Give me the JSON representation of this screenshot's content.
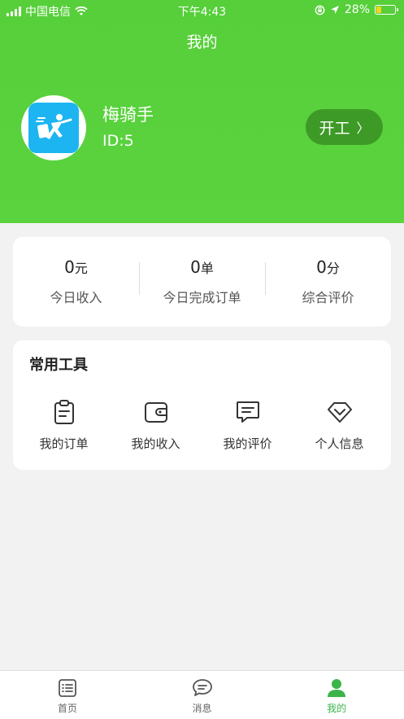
{
  "status_bar": {
    "carrier": "中国电信",
    "time": "下午4:43",
    "battery": "28%"
  },
  "header": {
    "title": "我的"
  },
  "profile": {
    "name": "梅骑手",
    "id_text": "ID:5",
    "start_button": "开工",
    "start_chevron": "〉"
  },
  "stats": [
    {
      "value": "0",
      "unit": "元",
      "label": "今日收入"
    },
    {
      "value": "0",
      "unit": "单",
      "label": "今日完成订单"
    },
    {
      "value": "0",
      "unit": "分",
      "label": "综合评价"
    }
  ],
  "tools": {
    "title": "常用工具",
    "items": [
      {
        "label": "我的订单",
        "icon": "clipboard-icon"
      },
      {
        "label": "我的收入",
        "icon": "wallet-icon"
      },
      {
        "label": "我的评价",
        "icon": "comment-icon"
      },
      {
        "label": "个人信息",
        "icon": "diamond-icon"
      }
    ]
  },
  "tabbar": {
    "items": [
      {
        "label": "首页",
        "icon": "list-icon"
      },
      {
        "label": "消息",
        "icon": "message-icon"
      },
      {
        "label": "我的",
        "icon": "person-icon"
      }
    ],
    "active_color": "#3bb54a"
  },
  "colors": {
    "header_green": "#5bd33f",
    "button_green": "#3e9a27",
    "avatar_blue": "#1cb5f2"
  }
}
